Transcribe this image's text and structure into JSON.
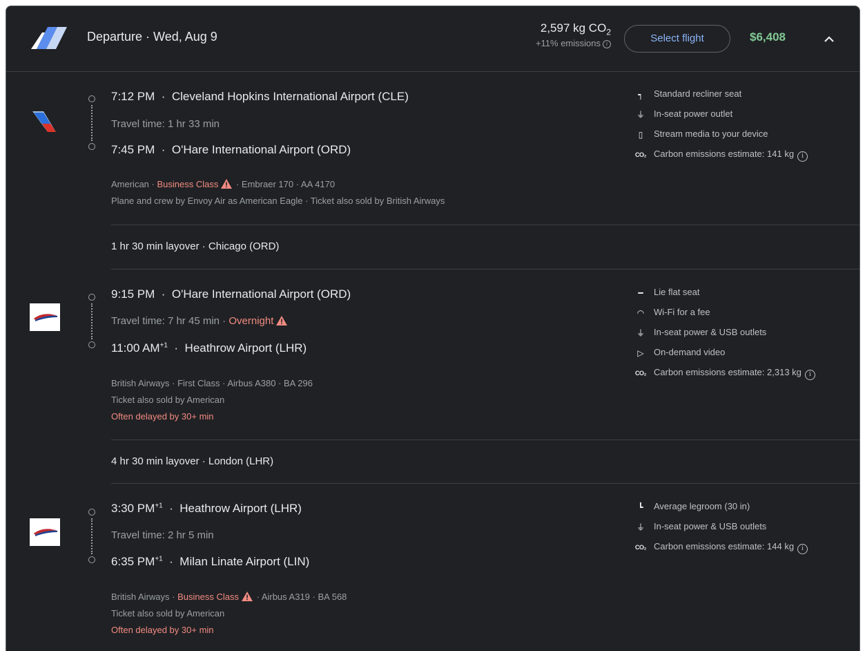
{
  "header": {
    "title": "Departure · Wed, Aug 9",
    "emissions_value": "2,597 kg CO",
    "emissions_sub": "2",
    "emissions_pct": "+11% emissions",
    "select_label": "Select flight",
    "price": "$6,408"
  },
  "legs": [
    {
      "dep_time": "7:12 PM",
      "dep_airport": "Cleveland Hopkins International Airport (CLE)",
      "travel_time": "Travel time: 1 hr 33 min",
      "arr_time": "7:45 PM",
      "arr_airport": "O'Hare International Airport (ORD)",
      "airline": "American",
      "cabin": "Business Class",
      "aircraft": "Embraer 170",
      "flight_no": "AA 4170",
      "note1": "Plane and crew by Envoy Air as American Eagle · Ticket also sold by British Airways",
      "amenities": [
        "Standard recliner seat",
        "In-seat power outlet",
        "Stream media to your device",
        "Carbon emissions estimate: 141 kg"
      ]
    },
    {
      "dep_time": "9:15 PM",
      "dep_airport": "O'Hare International Airport (ORD)",
      "travel_time": "Travel time: 7 hr 45 min",
      "travel_warn": "Overnight",
      "arr_time": "11:00 AM",
      "arr_sup": "+1",
      "arr_airport": "Heathrow Airport (LHR)",
      "airline": "British Airways",
      "cabin": "First Class",
      "aircraft": "Airbus A380",
      "flight_no": "BA 296",
      "note1": "Ticket also sold by American",
      "delay": "Often delayed by 30+ min",
      "amenities": [
        "Lie flat seat",
        "Wi-Fi for a fee",
        "In-seat power & USB outlets",
        "On-demand video",
        "Carbon emissions estimate: 2,313 kg"
      ]
    },
    {
      "dep_time": "3:30 PM",
      "dep_sup": "+1",
      "dep_airport": "Heathrow Airport (LHR)",
      "travel_time": "Travel time: 2 hr 5 min",
      "arr_time": "6:35 PM",
      "arr_sup": "+1",
      "arr_airport": "Milan Linate Airport (LIN)",
      "airline": "British Airways",
      "cabin": "Business Class",
      "aircraft": "Airbus A319",
      "flight_no": "BA 568",
      "note1": "Ticket also sold by American",
      "delay": "Often delayed by 30+ min",
      "amenities": [
        "Average legroom (30 in)",
        "In-seat power & USB outlets",
        "Carbon emissions estimate: 144 kg"
      ]
    }
  ],
  "layovers": [
    "1 hr 30 min layover · Chicago (ORD)",
    "4 hr 30 min layover · London (LHR)"
  ],
  "colors": {
    "background": "#202124",
    "accent_blue": "#8ab4f8",
    "price_green": "#81c995",
    "warning_red": "#f28b82"
  },
  "icons": {
    "header_logo": "multi-airline-logo",
    "leg1_logo": "american-airlines-logo",
    "leg2_logo": "british-airways-logo",
    "leg3_logo": "british-airways-logo"
  }
}
